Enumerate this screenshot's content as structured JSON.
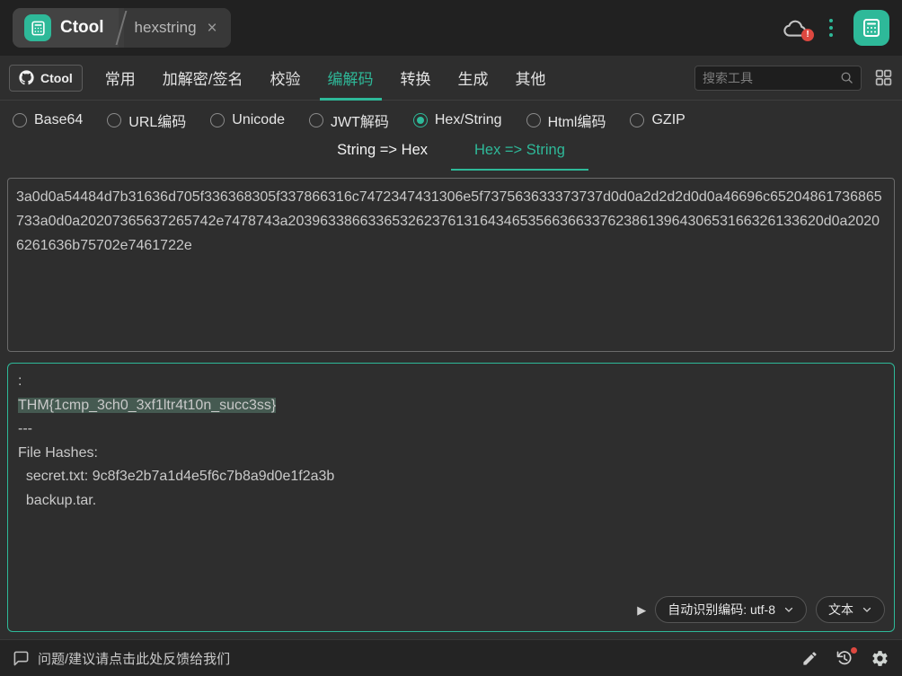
{
  "colors": {
    "accent": "#2eb999",
    "alert": "#dd4840",
    "selection_highlight": "#455a51"
  },
  "titlebar": {
    "app_tab_label": "Ctool",
    "tool_tab_label": "hexstring",
    "close_label": "×",
    "cloud_badge": "!"
  },
  "navbar": {
    "github_label": "Ctool",
    "items": [
      {
        "label": "常用",
        "active": false
      },
      {
        "label": "加解密/签名",
        "active": false
      },
      {
        "label": "校验",
        "active": false
      },
      {
        "label": "编解码",
        "active": true
      },
      {
        "label": "转换",
        "active": false
      },
      {
        "label": "生成",
        "active": false
      },
      {
        "label": "其他",
        "active": false
      }
    ],
    "search_placeholder": "搜索工具"
  },
  "codec_options": [
    {
      "label": "Base64",
      "selected": false
    },
    {
      "label": "URL编码",
      "selected": false
    },
    {
      "label": "Unicode",
      "selected": false
    },
    {
      "label": "JWT解码",
      "selected": false
    },
    {
      "label": "Hex/String",
      "selected": true
    },
    {
      "label": "Html编码",
      "selected": false
    },
    {
      "label": "GZIP",
      "selected": false
    }
  ],
  "mode_tabs": [
    {
      "label": "String => Hex",
      "active": false
    },
    {
      "label": "Hex => String",
      "active": true
    }
  ],
  "hex_input": "3a0d0a54484d7b31636d705f336368305f337866316c7472347431306e5f737563633373737d0d0a2d2d2d0d0a46696c65204861736865733a0d0a20207365637265742e7478743a2039633866336532623761316434653566366337623861396430653166326133620d0a20206261636b75702e7461722e",
  "output": {
    "lines": [
      {
        "text": ":",
        "highlighted": false
      },
      {
        "text": "THM{1cmp_3ch0_3xf1ltr4t10n_succ3ss}",
        "highlighted": true
      },
      {
        "text": "---",
        "highlighted": false
      },
      {
        "text": "File Hashes:",
        "highlighted": false
      },
      {
        "text": "  secret.txt: 9c8f3e2b7a1d4e5f6c7b8a9d0e1f2a3b",
        "highlighted": false
      },
      {
        "text": "  backup.tar.",
        "highlighted": false
      }
    ],
    "encoding_select": "自动识别编码: utf-8",
    "format_select": "文本",
    "play_glyph": "▶"
  },
  "statusbar": {
    "feedback": "问题/建议请点击此处反馈给我们"
  }
}
